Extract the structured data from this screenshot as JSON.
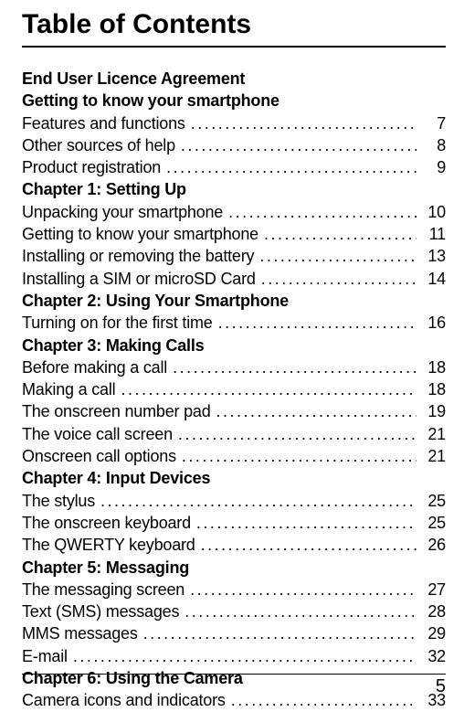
{
  "title": "Table of Contents",
  "page_number": "5",
  "sections": {
    "eula": "End User Licence Agreement",
    "intro": "Getting to know your smartphone",
    "ch1": "Chapter 1: Setting Up",
    "ch2": "Chapter 2: Using Your Smartphone",
    "ch3": "Chapter 3: Making Calls",
    "ch4": "Chapter 4: Input Devices",
    "ch5": "Chapter 5: Messaging",
    "ch6": "Chapter 6: Using the Camera"
  },
  "entries": {
    "features": {
      "label": "Features and functions",
      "page": "7"
    },
    "help": {
      "label": "Other sources of help",
      "page": "8"
    },
    "registration": {
      "label": "Product registration",
      "page": "9"
    },
    "unpacking": {
      "label": "Unpacking your smartphone",
      "page": "10"
    },
    "know": {
      "label": "Getting to know your smartphone",
      "page": "11"
    },
    "battery": {
      "label": "Installing or removing the battery",
      "page": "13"
    },
    "sim": {
      "label": "Installing a SIM or microSD Card",
      "page": "14"
    },
    "turnon": {
      "label": "Turning on for the first time",
      "page": "16"
    },
    "before_call": {
      "label": "Before making a call",
      "page": "18"
    },
    "making_call": {
      "label": "Making a call",
      "page": "18"
    },
    "numpad": {
      "label": "The onscreen number pad",
      "page": "19"
    },
    "voice_screen": {
      "label": "The voice call screen",
      "page": "21"
    },
    "call_options": {
      "label": "Onscreen call options",
      "page": "21"
    },
    "stylus": {
      "label": "The stylus",
      "page": "25"
    },
    "osk": {
      "label": "The onscreen keyboard",
      "page": "25"
    },
    "qwerty": {
      "label": "The QWERTY keyboard",
      "page": "26"
    },
    "msg_screen": {
      "label": "The messaging screen",
      "page": "27"
    },
    "sms": {
      "label": "Text (SMS) messages",
      "page": "28"
    },
    "mms": {
      "label": "MMS messages",
      "page": "29"
    },
    "email": {
      "label": "E-mail",
      "page": "32"
    },
    "camera_icons": {
      "label": "Camera icons and indicators",
      "page": "33"
    }
  }
}
